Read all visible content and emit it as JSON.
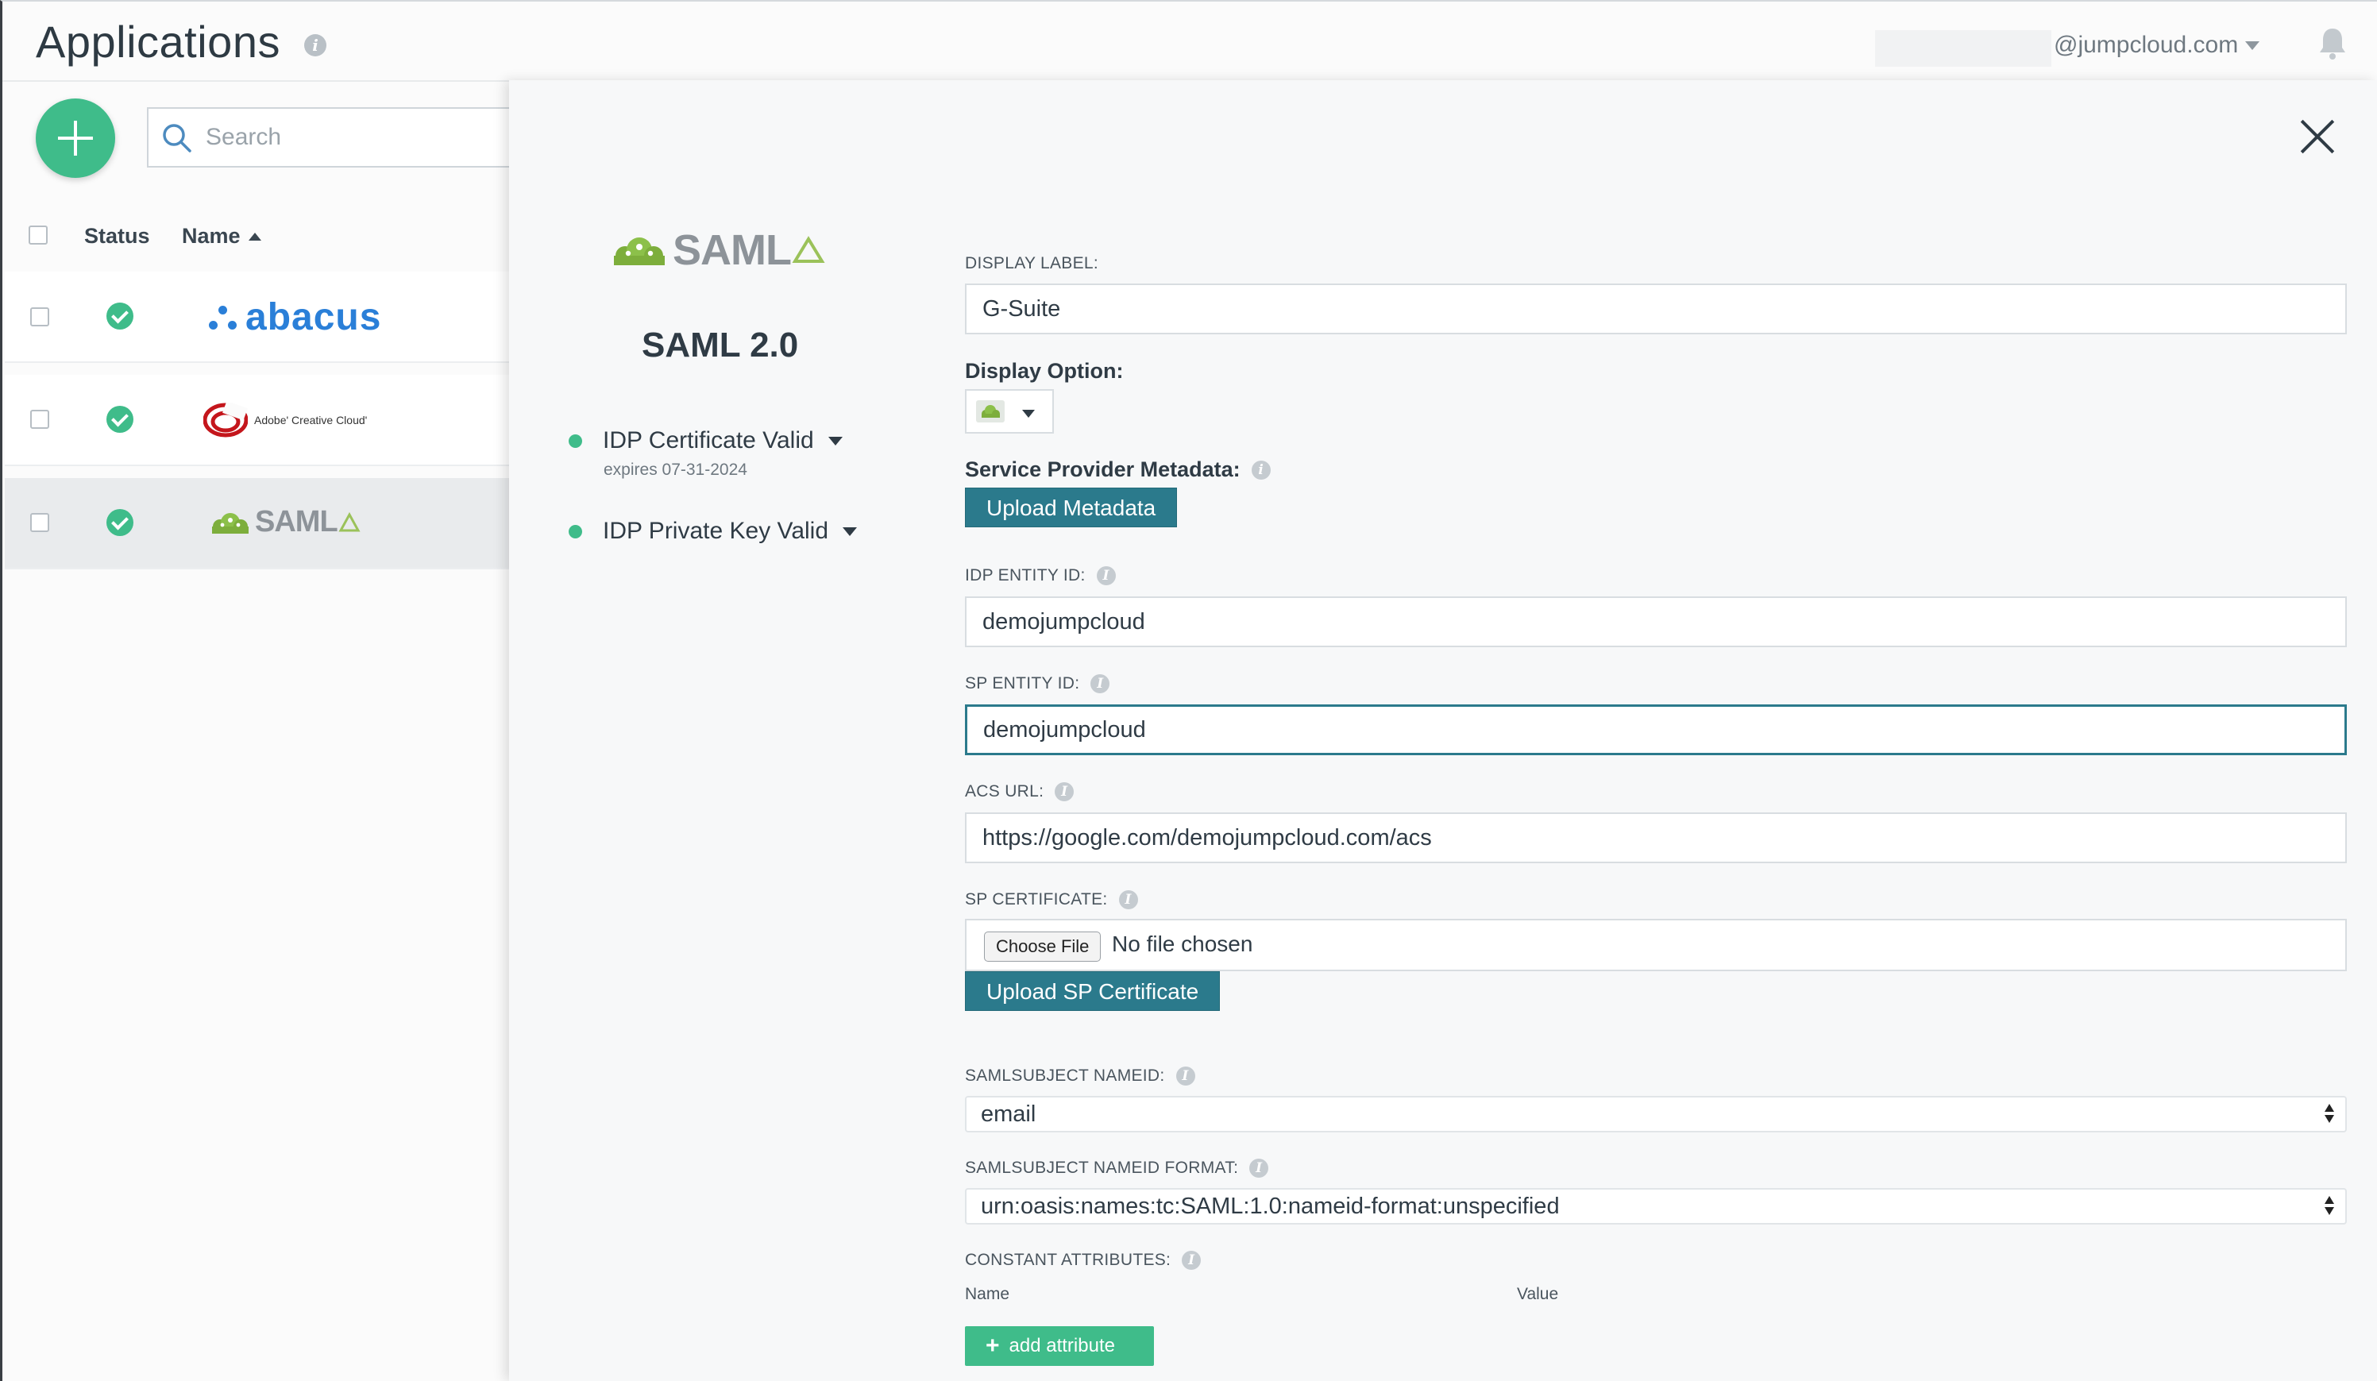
{
  "header": {
    "title": "Applications",
    "user_email": "@jumpcloud.com"
  },
  "search": {
    "placeholder": "Search"
  },
  "list": {
    "columns": {
      "status": "Status",
      "name": "Name"
    },
    "rows": [
      {
        "name": "abacus",
        "status": "active"
      },
      {
        "name": "Adobe Creative Cloud",
        "logo_text": "Adobe' Creative Cloud'",
        "status": "active"
      },
      {
        "name": "SAML",
        "status": "active",
        "selected": true
      }
    ]
  },
  "panel": {
    "logo_word": "SAML",
    "app_name": "SAML 2.0",
    "idp_certificate": {
      "label": "IDP Certificate Valid",
      "expires": "expires 07-31-2024"
    },
    "idp_private_key": {
      "label": "IDP Private Key Valid"
    },
    "form": {
      "display_label": {
        "label": "DISPLAY LABEL:",
        "value": "G-Suite"
      },
      "display_option": {
        "label": "Display Option:"
      },
      "sp_metadata": {
        "label": "Service Provider Metadata:",
        "button": "Upload Metadata"
      },
      "idp_entity_id": {
        "label": "IDP ENTITY ID:",
        "value": "demojumpcloud"
      },
      "sp_entity_id": {
        "label": "SP ENTITY ID:",
        "value": "demojumpcloud"
      },
      "acs_url": {
        "label": "ACS URL:",
        "value": "https://google.com/demojumpcloud.com/acs"
      },
      "sp_certificate": {
        "label": "SP CERTIFICATE:",
        "choose_file": "Choose File",
        "file_status": "No file chosen",
        "button": "Upload SP Certificate"
      },
      "nameid": {
        "label": "SAMLSUBJECT NAMEID:",
        "value": "email"
      },
      "nameid_format": {
        "label": "SAMLSUBJECT NAMEID FORMAT:",
        "value": "urn:oasis:names:tc:SAML:1.0:nameid-format:unspecified"
      },
      "constant_attributes": {
        "label": "CONSTANT ATTRIBUTES:",
        "col_name": "Name",
        "col_value": "Value",
        "button": "add attribute"
      }
    }
  },
  "colors": {
    "accent_green": "#3fbc8a",
    "accent_teal": "#2b7a8c",
    "abacus_blue": "#2a7fd8",
    "adobe_red": "#c4161c"
  }
}
